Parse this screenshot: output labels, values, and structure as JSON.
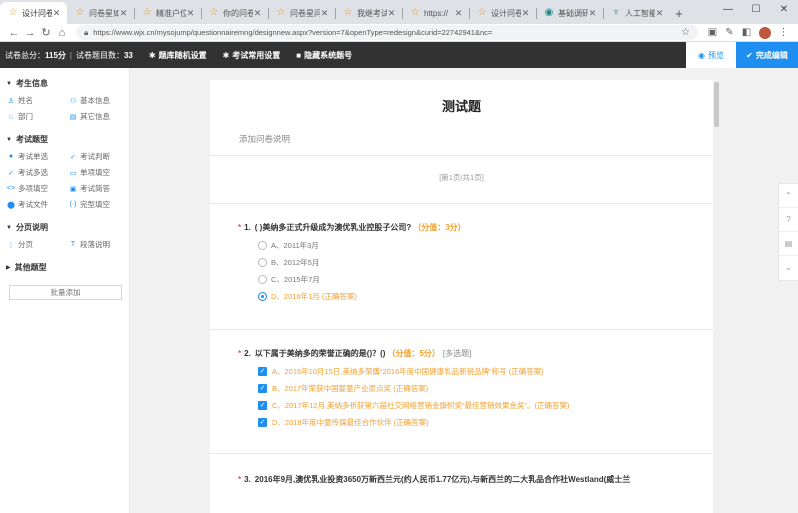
{
  "browser": {
    "tabs": [
      {
        "title": "设计问卷",
        "active": true
      },
      {
        "title": "问卷星如何"
      },
      {
        "title": "精准户位"
      },
      {
        "title": "你的问卷"
      },
      {
        "title": "问卷星问卷"
      },
      {
        "title": "我继考试"
      },
      {
        "title": "https://"
      },
      {
        "title": "设计问卷"
      },
      {
        "title": "基础调研"
      },
      {
        "title": "人工智能"
      }
    ],
    "new_tab": "+",
    "url": "https://www.wjx.cn/mysojump/questionnairemng/designnew.aspx?version=7&openType=redesign&curid=22742941&nc="
  },
  "toolbar": {
    "total_score_label": "试卷总分：",
    "total_score": "115分",
    "question_count_label": "试卷题目数：",
    "question_count": "33",
    "random_btn": "题库随机设置",
    "exam_btn": "考试常用设置",
    "hide_btn": "隐藏系统题号",
    "preview_btn": "预览",
    "finish_btn": "完成编辑"
  },
  "left": {
    "sections": [
      {
        "title": "考生信息",
        "items": [
          {
            "icon": "person-icon",
            "glyph": "♙",
            "label": "姓名"
          },
          {
            "icon": "id-card-icon",
            "glyph": "⚇",
            "label": "基本信息"
          },
          {
            "icon": "department-icon",
            "glyph": "♘",
            "label": "部门"
          },
          {
            "icon": "other-info-icon",
            "glyph": "▤",
            "label": "其它信息"
          }
        ]
      },
      {
        "title": "考试题型",
        "items": [
          {
            "icon": "radio-icon",
            "glyph": "●",
            "label": "考试单选"
          },
          {
            "icon": "judge-icon",
            "glyph": "✓",
            "label": "考试判断"
          },
          {
            "icon": "multi-check-icon",
            "glyph": "✓",
            "label": "考试多选"
          },
          {
            "icon": "blank-icon",
            "glyph": "▭",
            "label": "单项填空"
          },
          {
            "icon": "code-icon",
            "glyph": "<>",
            "label": "多项填空"
          },
          {
            "icon": "answer-icon",
            "glyph": "▣",
            "label": "考试简答"
          },
          {
            "icon": "file-icon",
            "glyph": "⬤",
            "label": "考试文件"
          },
          {
            "icon": "cloze-icon",
            "glyph": "(·)",
            "label": "完型填空"
          }
        ]
      },
      {
        "title": "分页说明",
        "items": [
          {
            "icon": "page-icon",
            "glyph": "⋮",
            "label": "分页"
          },
          {
            "icon": "paragraph-icon",
            "glyph": "T",
            "label": "段落说明"
          }
        ]
      },
      {
        "title": "其他题型",
        "collapsed": true,
        "items": []
      }
    ],
    "batch_add": "批量添加"
  },
  "survey": {
    "title": "测试题",
    "description": "添加问卷说明",
    "pager": "[第1页/共1页]",
    "questions": [
      {
        "number": "1.",
        "text": "( )美纳多正式升级成为澳优乳业控股子公司?",
        "score": "（分值：3分）",
        "tag": "",
        "type": "radio",
        "options": [
          {
            "label": "A、2011年3月",
            "selected": false,
            "correct": false
          },
          {
            "label": "B、2012年5月",
            "selected": false,
            "correct": false
          },
          {
            "label": "C、2015年7月",
            "selected": false,
            "correct": false
          },
          {
            "label": "D、2016年1月 (正确答案)",
            "selected": true,
            "correct": true
          }
        ]
      },
      {
        "number": "2.",
        "text": "以下属于美纳多的荣誉正确的是()？()",
        "score": "（分值：5分）",
        "tag": "[多选题]",
        "type": "checkbox",
        "options": [
          {
            "label": "A、2016年10月15日,美纳多荣膺“2016年度中国健康乳品新锐品牌”称号 (正确答案)",
            "selected": true,
            "correct": true
          },
          {
            "label": "B、2017年荣获中国婴童产业原点奖 (正确答案)",
            "selected": true,
            "correct": true
          },
          {
            "label": "C、2017年12月,美纳多祈获第六届社交网络营销金旗帜奖“最佳营销效果金奖”。(正确答案)",
            "selected": true,
            "correct": true
          },
          {
            "label": "D、2018年度中童传媒最佳合作伙伴 (正确答案)",
            "selected": true,
            "correct": true
          }
        ]
      },
      {
        "number": "3.",
        "text": "2016年9月,澳优乳业投资3650万新西兰元(约人民币1.77亿元),与新西兰的二大乳品合作社Westland(威士兰",
        "score": "",
        "tag": "",
        "type": "radio",
        "options": []
      }
    ]
  },
  "right_float": [
    {
      "icon": "chevron-up-icon",
      "glyph": "⌃"
    },
    {
      "icon": "help-icon",
      "glyph": "?"
    },
    {
      "icon": "chat-icon",
      "glyph": "▤"
    },
    {
      "icon": "chevron-down-icon",
      "glyph": "⌄"
    }
  ]
}
